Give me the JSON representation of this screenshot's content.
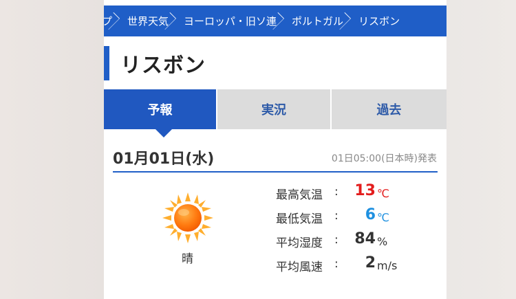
{
  "breadcrumb": {
    "items": [
      "プ",
      "世界天気",
      "ヨーロッパ・旧ソ連",
      "ポルトガル",
      "リスボン"
    ]
  },
  "page_title": "リスボン",
  "tabs": [
    {
      "label": "予報",
      "active": true
    },
    {
      "label": "実況",
      "active": false
    },
    {
      "label": "過去",
      "active": false
    }
  ],
  "forecast": {
    "date": "01月01日(水)",
    "issued": "01日05:00(日本時)発表",
    "condition": "晴",
    "icon": "sun-icon"
  },
  "stats": [
    {
      "label": "最高気温",
      "colon": ":",
      "value": "13",
      "unit": "℃",
      "color": "#e31d1d"
    },
    {
      "label": "最低気温",
      "colon": ":",
      "value": "6",
      "unit": "℃",
      "color": "#1e90e0"
    },
    {
      "label": "平均湿度",
      "colon": ":",
      "value": "84",
      "unit": "%",
      "color": "#333333"
    },
    {
      "label": "平均風速",
      "colon": ":",
      "value": "2",
      "unit": "m/s",
      "color": "#333333"
    }
  ],
  "colors": {
    "accent": "#1f5ec7",
    "tab_active": "#2058c0",
    "tab_inactive": "#dcdcdc"
  }
}
